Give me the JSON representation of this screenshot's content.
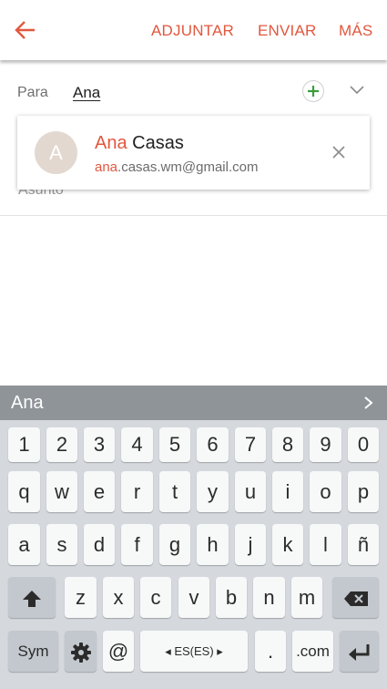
{
  "toolbar": {
    "attach_label": "ADJUNTAR",
    "send_label": "ENVIAR",
    "more_label": "MÁS"
  },
  "compose": {
    "to_label": "Para",
    "to_value": "Ana",
    "subject_label": "Asunto"
  },
  "suggestion": {
    "avatar_letter": "A",
    "name_match": "Ana",
    "name_rest": " Casas",
    "email_match": "ana",
    "email_rest": ".casas.wm@gmail.com"
  },
  "keyboard": {
    "prediction": "Ana",
    "row_numbers": [
      "1",
      "2",
      "3",
      "4",
      "5",
      "6",
      "7",
      "8",
      "9",
      "0"
    ],
    "row1": [
      "q",
      "w",
      "e",
      "r",
      "t",
      "y",
      "u",
      "i",
      "o",
      "p"
    ],
    "row2": [
      "a",
      "s",
      "d",
      "f",
      "g",
      "h",
      "j",
      "k",
      "l",
      "ñ"
    ],
    "row3": [
      "z",
      "x",
      "c",
      "v",
      "b",
      "n",
      "m"
    ],
    "sym_label": "Sym",
    "at_label": "@",
    "language_label": "ES(ES)",
    "period_label": ".",
    "dotcom_label": ".com"
  },
  "colors": {
    "accent": "#e2573e",
    "add_green": "#3a9d3a",
    "avatar": "#e2d8cf"
  },
  "icons": [
    "back-arrow-icon",
    "add-recipient-icon",
    "expand-icon",
    "close-icon",
    "shift-icon",
    "backspace-icon",
    "settings-icon",
    "enter-icon",
    "chevron-right-icon"
  ]
}
